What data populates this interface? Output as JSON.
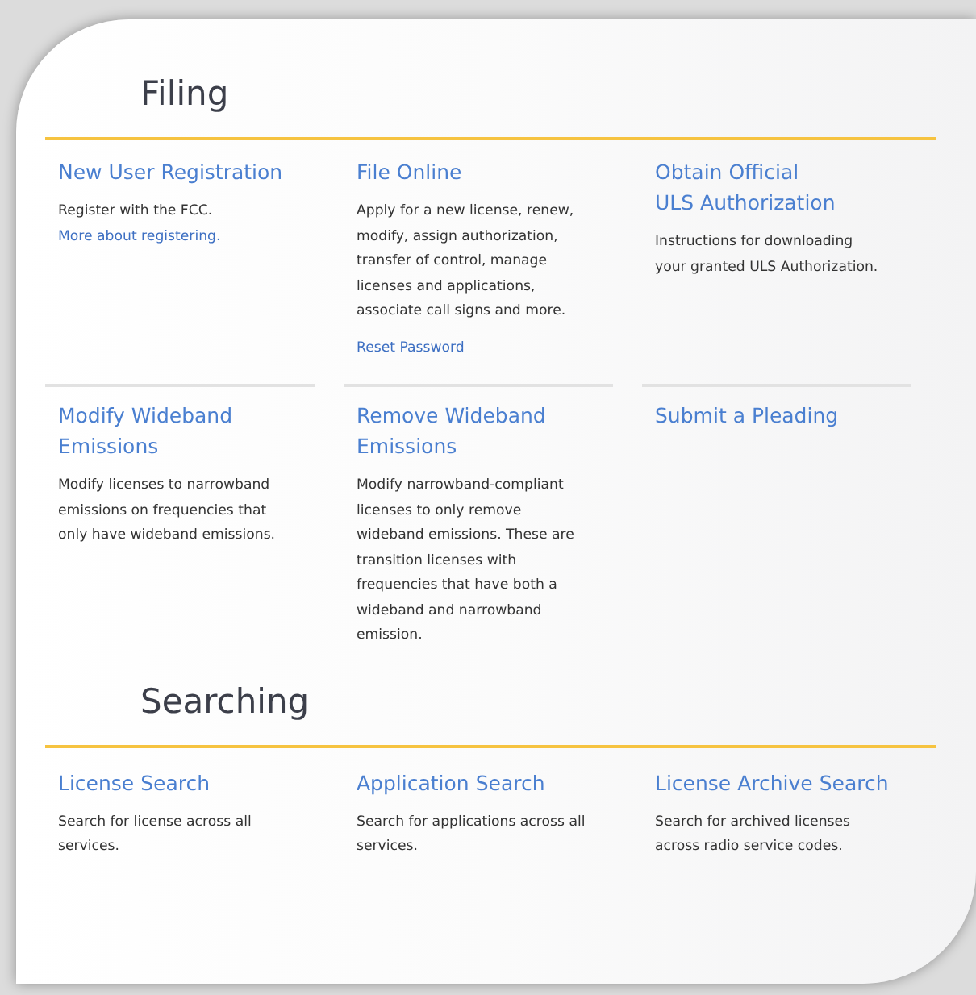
{
  "sections": [
    {
      "heading": "Filing",
      "rows": [
        [
          {
            "title": "New User Registration",
            "description": "Register with the FCC.",
            "link": {
              "text": "More about registering.",
              "kind": "inline"
            }
          },
          {
            "title": "File Online",
            "description": "Apply for a new license, renew,\nmodify, assign authorization,\ntransfer of control, manage\nlicenses and applications,\nassociate call signs and more.",
            "link": {
              "text": "Reset Password",
              "kind": "below"
            }
          },
          {
            "title": "Obtain Official\nULS Authorization",
            "description": "Instructions for downloading\nyour granted ULS Authorization."
          }
        ],
        [
          {
            "title": "Modify Wideband\nEmissions",
            "description": "Modify licenses to narrowband\nemissions on frequencies that\nonly have wideband emissions."
          },
          {
            "title": "Remove Wideband\nEmissions",
            "description": "Modify narrowband-compliant\nlicenses to only remove\nwideband emissions. These are\ntransition licenses with\nfrequencies that have both a\nwideband and narrowband\nemission."
          },
          {
            "title": "Submit a Pleading"
          }
        ]
      ]
    },
    {
      "heading": "Searching",
      "rows": [
        [
          {
            "title": "License Search",
            "description": "Search for license across all\nservices."
          },
          {
            "title": "Application Search",
            "description": "Search for applications across all\nservices."
          },
          {
            "title": "License Archive Search",
            "description": "Search for archived licenses\nacross radio service codes."
          }
        ]
      ]
    }
  ]
}
